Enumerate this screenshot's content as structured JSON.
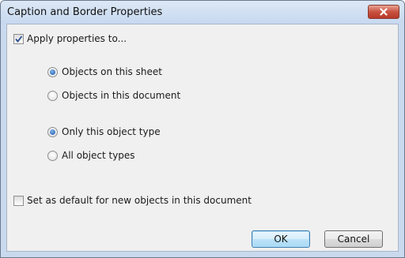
{
  "window": {
    "title": "Caption and Border Properties"
  },
  "apply_properties": {
    "label": "Apply properties to...",
    "checked": true
  },
  "scope_options": [
    {
      "label": "Objects on this sheet",
      "selected": true
    },
    {
      "label": "Objects in this document",
      "selected": false
    }
  ],
  "type_options": [
    {
      "label": "Only this object type",
      "selected": true
    },
    {
      "label": "All object types",
      "selected": false
    }
  ],
  "set_default": {
    "label": "Set as default for new objects in this document",
    "checked": false
  },
  "buttons": {
    "ok": "OK",
    "cancel": "Cancel"
  },
  "colors": {
    "frame": "#c9d9ee",
    "client": "#f0f0f0",
    "close_button": "#c8513f",
    "default_button_border": "#3c7fb1"
  }
}
